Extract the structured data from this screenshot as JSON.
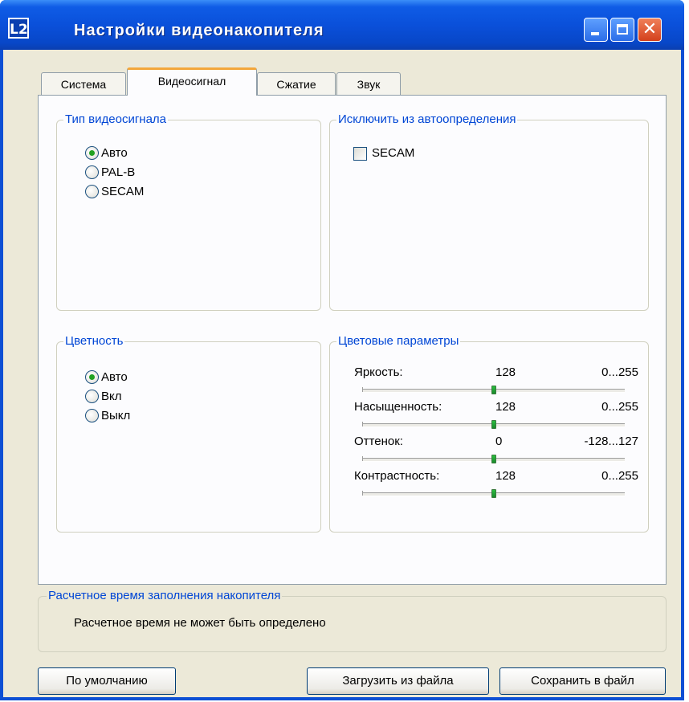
{
  "window": {
    "title": "Настройки видеонакопителя",
    "icon_text": "L2",
    "controls": [
      "minimize-icon",
      "maximize-icon",
      "close-icon"
    ]
  },
  "tabs": [
    "Система",
    "Видеосигнал",
    "Сжатие",
    "Звук"
  ],
  "active_tab": "Видеосигнал",
  "signal_type": {
    "legend": "Тип видеосигнала",
    "options": [
      "Авто",
      "PAL-B",
      "SECAM"
    ],
    "selected": "Авто"
  },
  "exclude_autodetect": {
    "legend": "Исключить из автоопределения",
    "checkbox_label": "SECAM",
    "checked": false
  },
  "color_mode": {
    "legend": "Цветность",
    "options": [
      "Авто",
      "Вкл",
      "Выкл"
    ],
    "selected": "Авто"
  },
  "color_params": {
    "legend": "Цветовые параметры",
    "params": [
      {
        "label": "Яркость:",
        "value": "128",
        "range": "0...255",
        "min": 0,
        "max": 255,
        "current": 128
      },
      {
        "label": "Насыщенность:",
        "value": "128",
        "range": "0...255",
        "min": 0,
        "max": 255,
        "current": 128
      },
      {
        "label": "Оттенок:",
        "value": "0",
        "range": "-128...127",
        "min": -128,
        "max": 127,
        "current": 0
      },
      {
        "label": "Контрастность:",
        "value": "128",
        "range": "0...255",
        "min": 0,
        "max": 255,
        "current": 128
      }
    ]
  },
  "estimate": {
    "legend": "Расчетное время заполнения накопителя",
    "text": "Расчетное время не может быть определено"
  },
  "buttons": {
    "default": "По умолчанию",
    "load": "Загрузить из файла",
    "save": "Сохранить в файл"
  },
  "colors": {
    "title_bar": "#0a50da",
    "legend_text": "#0046d5",
    "radio_dot": "#21a121",
    "active_tab_accent": "#f3a73c",
    "dialog_bg": "#ece9d8",
    "close_button": "#d3401c"
  }
}
